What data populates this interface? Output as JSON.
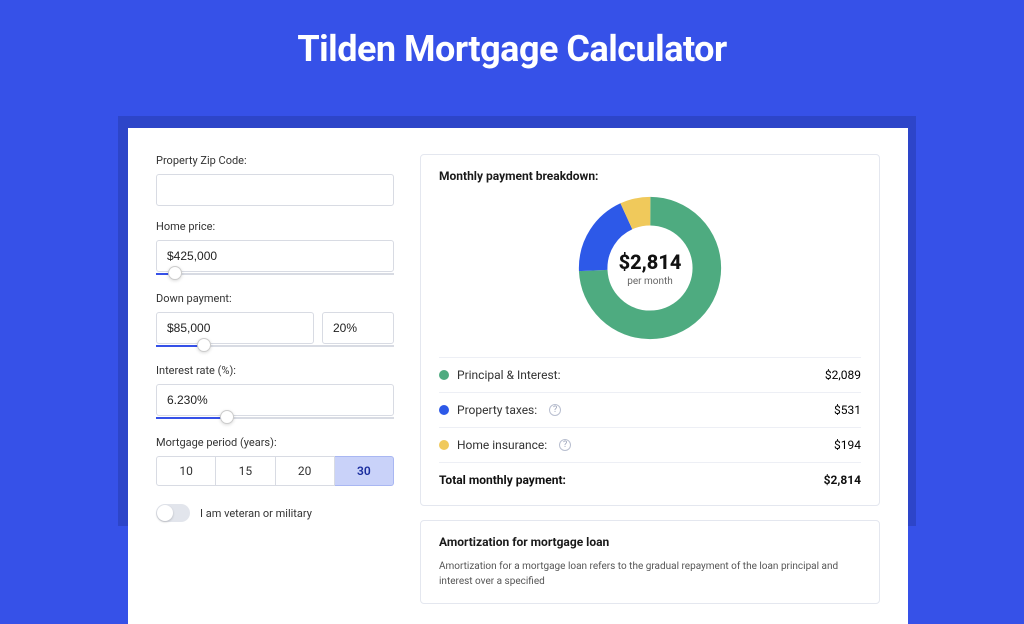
{
  "title": "Tilden Mortgage Calculator",
  "form": {
    "zip_label": "Property Zip Code:",
    "zip_value": "",
    "price_label": "Home price:",
    "price_value": "$425,000",
    "price_slider_pct": 8,
    "down_label": "Down payment:",
    "down_value": "$85,000",
    "down_pct_value": "20%",
    "down_slider_pct": 20,
    "rate_label": "Interest rate (%):",
    "rate_value": "6.230%",
    "rate_slider_pct": 30,
    "period_label": "Mortgage period (years):",
    "period_options": [
      "10",
      "15",
      "20",
      "30"
    ],
    "period_selected": "30",
    "veteran_label": "I am veteran or military",
    "veteran_on": false
  },
  "breakdown": {
    "title": "Monthly payment breakdown:",
    "donut_amount": "$2,814",
    "donut_sub": "per month",
    "items": [
      {
        "label": "Principal & Interest:",
        "value": "$2,089",
        "color": "#4eab80",
        "help": false
      },
      {
        "label": "Property taxes:",
        "value": "$531",
        "color": "#2d59e8",
        "help": true
      },
      {
        "label": "Home insurance:",
        "value": "$194",
        "color": "#f0c95b",
        "help": true
      }
    ],
    "total_label": "Total monthly payment:",
    "total_value": "$2,814"
  },
  "amortization": {
    "title": "Amortization for mortgage loan",
    "text": "Amortization for a mortgage loan refers to the gradual repayment of the loan principal and interest over a specified"
  },
  "chart_data": {
    "type": "pie",
    "title": "Monthly payment breakdown",
    "series": [
      {
        "name": "Principal & Interest",
        "value": 2089,
        "color": "#4eab80"
      },
      {
        "name": "Property taxes",
        "value": 531,
        "color": "#2d59e8"
      },
      {
        "name": "Home insurance",
        "value": 194,
        "color": "#f0c95b"
      }
    ],
    "total": 2814,
    "center_label": "$2,814 per month"
  }
}
